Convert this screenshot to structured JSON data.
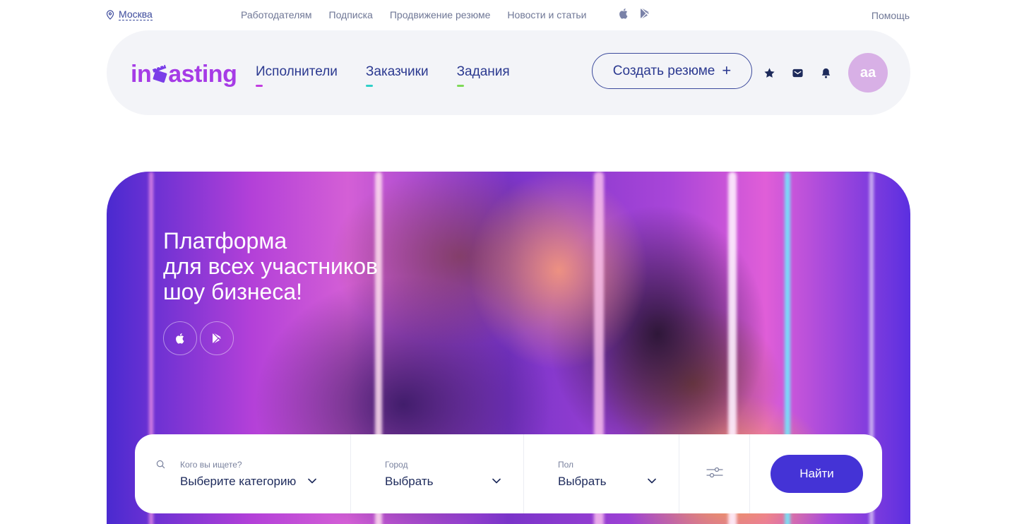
{
  "topbar": {
    "city": "Москва",
    "links": [
      "Работодателям",
      "Подписка",
      "Продвижение резюме",
      "Новости и статьи"
    ],
    "help": "Помощь",
    "app_icons": [
      "apple-icon",
      "google-play-icon"
    ]
  },
  "header": {
    "logo_text_left": "in",
    "logo_text_right": "asting",
    "nav": [
      {
        "label": "Исполнители",
        "accent": "#c23be0"
      },
      {
        "label": "Заказчики",
        "accent": "#2fd0c8"
      },
      {
        "label": "Задания",
        "accent": "#7ed957"
      }
    ],
    "create_button": "Создать резюме",
    "icons": [
      "star-icon",
      "mail-icon",
      "bell-icon"
    ],
    "avatar_initials": "aa"
  },
  "hero": {
    "title": "Платформа\nдля всех участников\nшоу бизнеса!",
    "app_buttons": [
      "apple-icon",
      "google-play-icon"
    ]
  },
  "search": {
    "category": {
      "label": "Кого вы ищете?",
      "value": "Выберите категорию"
    },
    "city": {
      "label": "Город",
      "value": "Выбрать"
    },
    "gender": {
      "label": "Пол",
      "value": "Выбрать"
    },
    "filters_icon": "filters-icon",
    "submit": "Найти"
  },
  "colors": {
    "brand_purple": "#a63be6",
    "primary_blue": "#4433d6",
    "nav_text": "#2b3990",
    "avatar_bg": "#d8b0e6"
  }
}
